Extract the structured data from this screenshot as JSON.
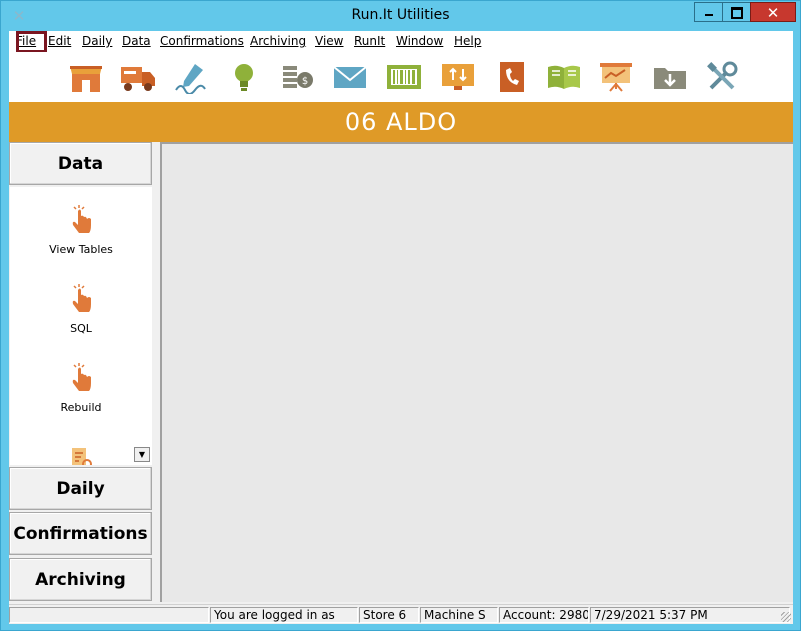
{
  "window": {
    "title": "Run.It Utilities"
  },
  "menu": [
    {
      "label": "File"
    },
    {
      "label": "Edit"
    },
    {
      "label": "Daily"
    },
    {
      "label": "Data"
    },
    {
      "label": "Confirmations"
    },
    {
      "label": "Archiving"
    },
    {
      "label": "View"
    },
    {
      "label": "RunIt"
    },
    {
      "label": "Window"
    },
    {
      "label": "Help"
    }
  ],
  "toolbar": [
    "store-icon",
    "delivery-truck-icon",
    "signature-pen-icon",
    "lightbulb-icon",
    "coins-icon",
    "envelope-icon",
    "barcode-icon",
    "transfer-monitor-icon",
    "phone-book-icon",
    "open-book-icon",
    "presentation-board-icon",
    "download-folder-icon",
    "tools-icon"
  ],
  "banner": {
    "store": "06 ALDO"
  },
  "sidebar": {
    "active_section": "Data",
    "items": [
      {
        "label": "View Tables"
      },
      {
        "label": "SQL"
      },
      {
        "label": "Rebuild"
      }
    ],
    "sections": [
      "Daily",
      "Confirmations",
      "Archiving"
    ]
  },
  "status": {
    "logged_in": "You are logged in as",
    "store": "Store 6",
    "machine": "Machine S",
    "account": "Account: 2980",
    "datetime": "7/29/2021 5:37 PM"
  },
  "colors": {
    "titlebar": "#62c8ea",
    "banner": "#df9a27",
    "close": "#c7382e",
    "icon_orange": "#e07a3a",
    "icon_green": "#8fb13a"
  }
}
